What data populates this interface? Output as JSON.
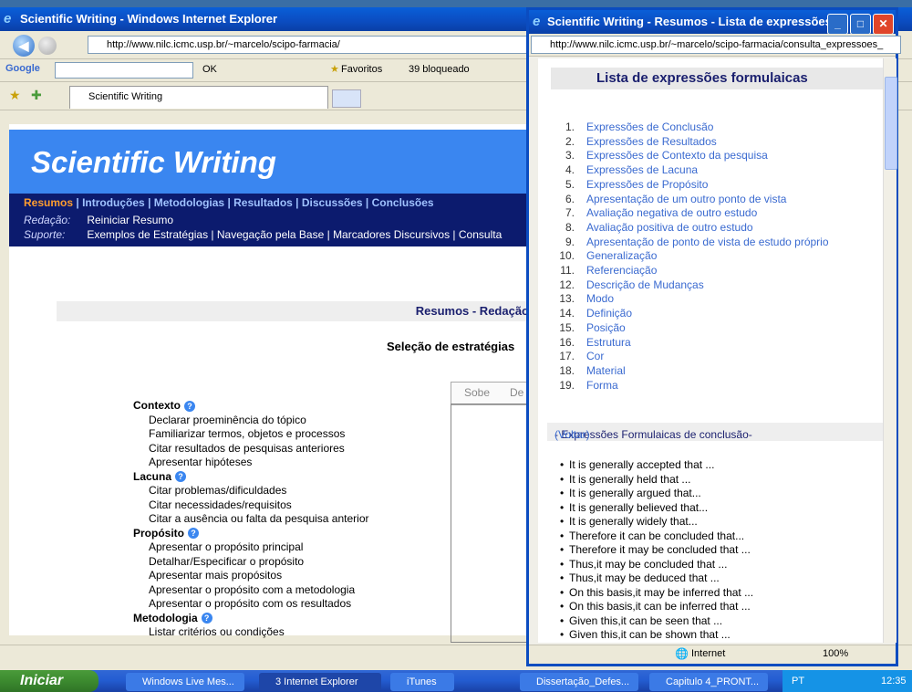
{
  "main_window": {
    "title": "Scientific Writing - Windows Internet Explorer",
    "address": "http://www.nilc.icmc.usp.br/~marcelo/scipo-farmacia/",
    "google_label": "Google",
    "ok_label": "OK",
    "favorites_label": "Favoritos",
    "blocked_label": "39 bloqueado",
    "tab_label": "Scientific Writing"
  },
  "site": {
    "banner_title": "Scientific Writing",
    "sections": [
      "Resumos",
      "Introduções",
      "Metodologias",
      "Resultados",
      "Discussões",
      "Conclusões"
    ],
    "redacao_label": "Redação:",
    "redacao_value": "Reiniciar Resumo",
    "suporte_label": "Suporte:",
    "suporte_value": "Exemplos de Estratégias | Navegação pela Base | Marcadores Discursivos | Consulta",
    "page_heading": "Resumos - Redação",
    "page_subtitle": "Seleção de estratégias",
    "tabs": [
      "Sobe",
      "De"
    ],
    "groups": [
      {
        "name": "Contexto",
        "items": [
          "Declarar proeminência do tópico",
          "Familiarizar termos, objetos e processos",
          "Citar resultados de pesquisas anteriores",
          "Apresentar hipóteses"
        ]
      },
      {
        "name": "Lacuna",
        "items": [
          "Citar problemas/dificuldades",
          "Citar necessidades/requisitos",
          "Citar a ausência ou falta da pesquisa anterior"
        ]
      },
      {
        "name": "Propósito",
        "items": [
          "Apresentar o propósito principal",
          "Detalhar/Especificar o propósito",
          "Apresentar mais propósitos",
          "Apresentar o propósito com a metodologia",
          "Apresentar o propósito com os resultados"
        ]
      },
      {
        "name": "Metodologia",
        "items": [
          "Listar critérios ou condições"
        ]
      }
    ]
  },
  "popup": {
    "title": "Scientific Writing - Resumos - Lista de expressões...",
    "address": "http://www.nilc.icmc.usp.br/~marcelo/scipo-farmacia/consulta_expressoes_",
    "heading": "Lista de expressões formulaicas",
    "list": [
      "Expressões de Conclusão",
      "Expressões de Resultados",
      "Expressões de Contexto da pesquisa",
      "Expressões de Lacuna",
      "Expressões de Propósito",
      "Apresentação de um outro ponto de vista",
      "Avaliação negativa de outro estudo",
      "Avaliação positiva de outro estudo",
      "Apresentação de ponto de vista de estudo próprio",
      "Generalização",
      "Referenciação",
      "Descrição de Mudanças",
      "Modo",
      "Definição",
      "Posição",
      "Estrutura",
      "Cor",
      "Material",
      "Forma"
    ],
    "subheading": "- Expressões Formulaicas de conclusão-",
    "back_link": "(Voltar)",
    "expressions": [
      "It is generally accepted that ...",
      "It is generally held that ...",
      "It is generally argued that...",
      "It is generally believed that...",
      "It is generally widely that...",
      "Therefore it can be concluded that...",
      "Therefore it may be concluded that ...",
      "Thus,it may be concluded that ...",
      "Thus,it may be deduced that ...",
      "On this basis,it may be inferred that ...",
      "On this basis,it can be inferred that ...",
      "Given this,it can be seen that ...",
      "Given this,it can be shown that ..."
    ],
    "status_zone": "Internet",
    "zoom": "100%"
  },
  "taskbar": {
    "start": "Iniciar",
    "buttons": [
      "Windows Live Mes...",
      "3 Internet Explorer",
      "iTunes",
      "Dissertação_Defes...",
      "Capitulo 4_PRONT..."
    ],
    "lang": "PT",
    "clock": "12:35"
  },
  "colors": {
    "banner": "#3a86f0",
    "nav": "#0c1b6e",
    "active_section": "#ff9d2f",
    "link": "#3a6ad0"
  }
}
